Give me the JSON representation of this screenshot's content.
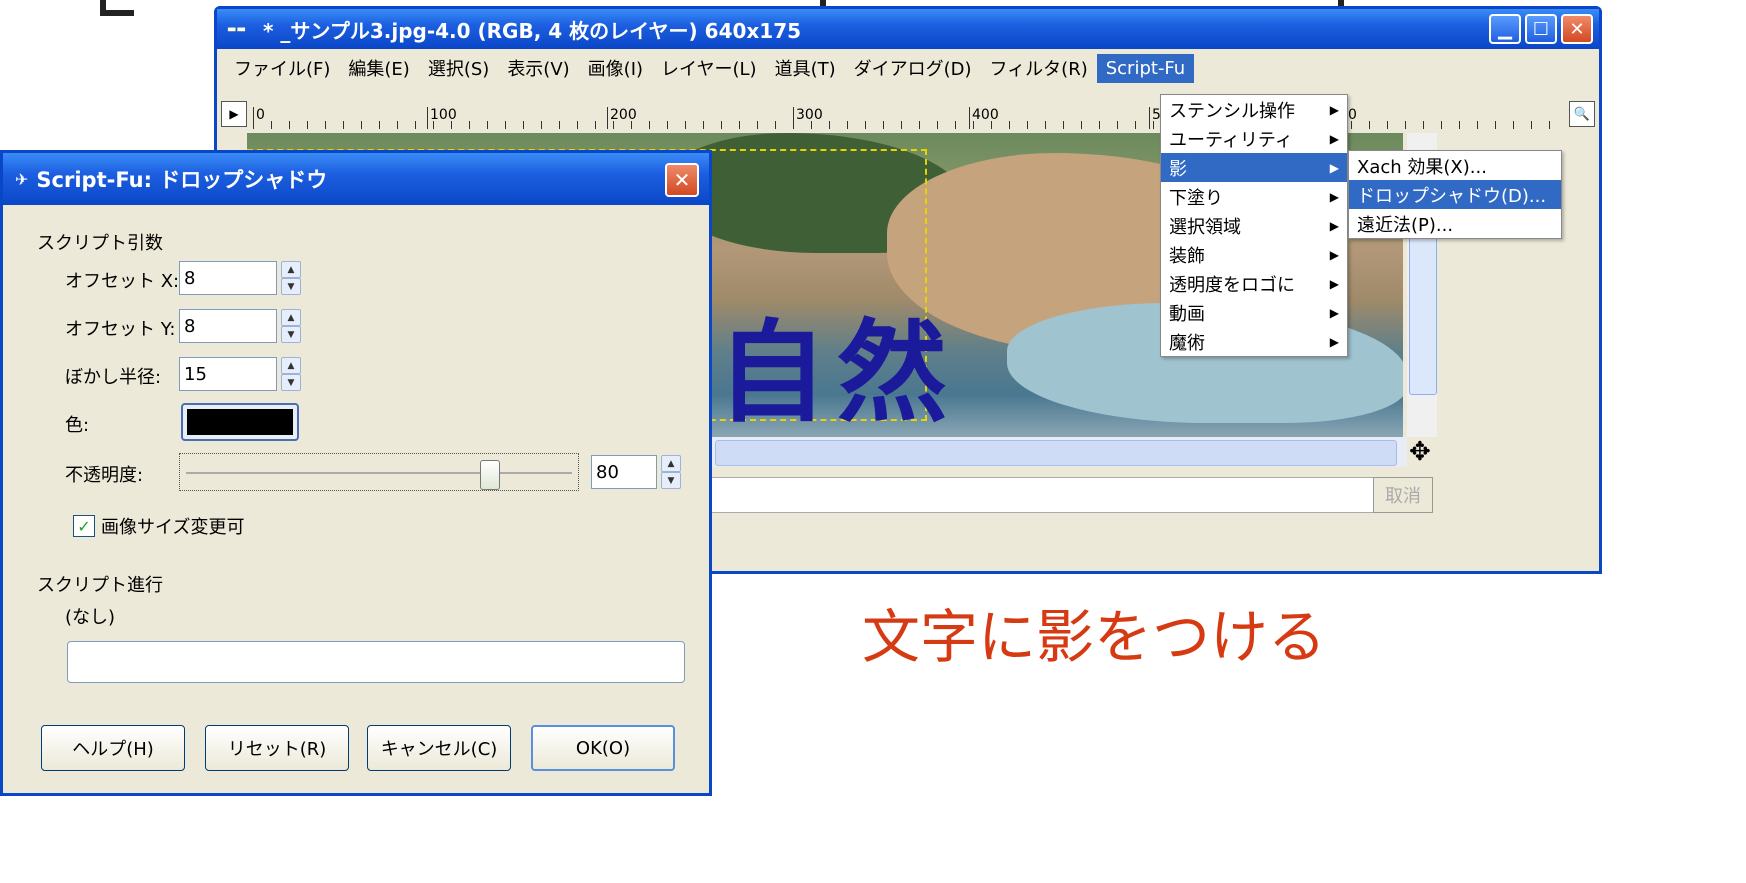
{
  "image_window": {
    "title": "* _サンプル3.jpg-4.0 (RGB, 4 枚のレイヤー) 640x175",
    "menus": [
      "ファイル(F)",
      "編集(E)",
      "選択(S)",
      "表示(V)",
      "画像(I)",
      "レイヤー(L)",
      "道具(T)",
      "ダイアログ(D)",
      "フィルタ(R)",
      "Script-Fu"
    ],
    "ruler_labels": [
      "0",
      "100",
      "200",
      "300",
      "400",
      "5",
      "0"
    ],
    "canvas_text": "自然",
    "cancel_label": "取消"
  },
  "scriptfu_menu": {
    "items": [
      "ステンシル操作",
      "ユーティリティ",
      "影",
      "下塗り",
      "選択領域",
      "装飾",
      "透明度をロゴに",
      "動画",
      "魔術"
    ],
    "highlighted": "影"
  },
  "shadow_submenu": {
    "items": [
      "Xach 効果(X)...",
      "ドロップシャドウ(D)...",
      "遠近法(P)..."
    ],
    "highlighted": "ドロップシャドウ(D)..."
  },
  "dialog": {
    "title": "Script-Fu: ドロップシャドウ",
    "section_args": "スクリプト引数",
    "offset_x_label": "オフセット X:",
    "offset_x_value": "8",
    "offset_y_label": "オフセット Y:",
    "offset_y_value": "8",
    "blur_label": "ぼかし半径:",
    "blur_value": "15",
    "color_label": "色:",
    "color_value": "#000000",
    "opacity_label": "不透明度:",
    "opacity_value": "80",
    "opacity_fraction": 0.8,
    "resize_label": "画像サイズ変更可",
    "resize_checked": true,
    "section_progress": "スクリプト進行",
    "progress_text": "(なし)",
    "buttons": {
      "help": "ヘルプ(H)",
      "reset": "リセット(R)",
      "cancel": "キャンセル(C)",
      "ok": "OK(O)"
    }
  },
  "caption": "文字に影をつける",
  "colors": {
    "titlebar": "#0a47c8",
    "menu_highlight": "#316ac5",
    "caption": "#d63a12",
    "window_bg": "#ece9d8"
  }
}
